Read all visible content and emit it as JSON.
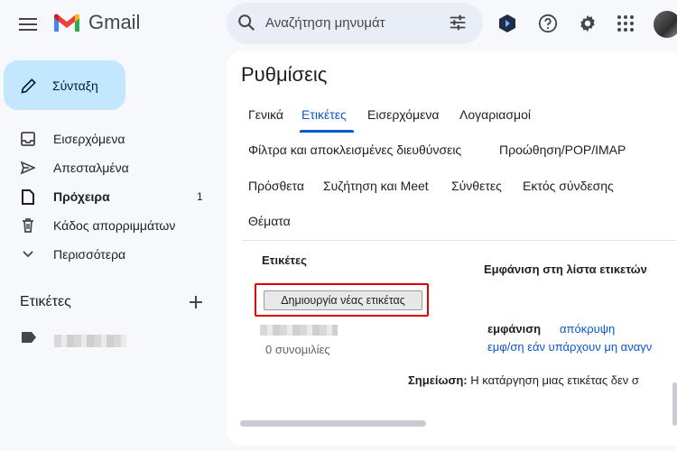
{
  "header": {
    "app_name": "Gmail",
    "search_placeholder": "Αναζήτηση μηνυμάτ"
  },
  "compose": {
    "label": "Σύνταξη"
  },
  "sidebar": {
    "items": [
      {
        "label": "Εισερχόμενα",
        "icon": "inbox-icon",
        "count": ""
      },
      {
        "label": "Απεσταλμένα",
        "icon": "send-icon",
        "count": ""
      },
      {
        "label": "Πρόχειρα",
        "icon": "draft-icon",
        "count": "1"
      },
      {
        "label": "Κάδος απορριμμάτων",
        "icon": "trash-icon",
        "count": ""
      },
      {
        "label": "Περισσότερα",
        "icon": "chevron-down-icon",
        "count": ""
      }
    ],
    "labels_heading": "Ετικέτες"
  },
  "settings": {
    "title": "Ρυθμίσεις",
    "tabs_row1": [
      "Γενικά",
      "Ετικέτες",
      "Εισερχόμενα",
      "Λογαριασμοί"
    ],
    "tabs_row2": [
      "Φίλτρα και αποκλεισμένες διευθύνσεις",
      "Προώθηση/POP/IMAP"
    ],
    "tabs_row3": [
      "Πρόσθετα",
      "Συζήτηση και Meet",
      "Σύνθετες",
      "Εκτός σύνδεσης"
    ],
    "tabs_row4": [
      "Θέματα"
    ],
    "active_tab": "Ετικέτες",
    "labels_section": "Ετικέτες",
    "show_in_list_header": "Εμφάνιση στη λίστα ετικετών",
    "create_button": "Δημιουργία νέας ετικέτας",
    "label_conversations": "0 συνομιλίες",
    "show_label": "εμφάνιση",
    "hide_link": "απόκρυψη",
    "show_if_unread_link": "εμφ/ση εάν υπάρχουν μη αναγν",
    "note_bold": "Σημείωση:",
    "note_text": " Η κατάργηση μιας ετικέτας δεν σ"
  },
  "colors": {
    "accent": "#0b57d0",
    "compose_bg": "#c2e7ff",
    "highlight": "#e00000"
  }
}
